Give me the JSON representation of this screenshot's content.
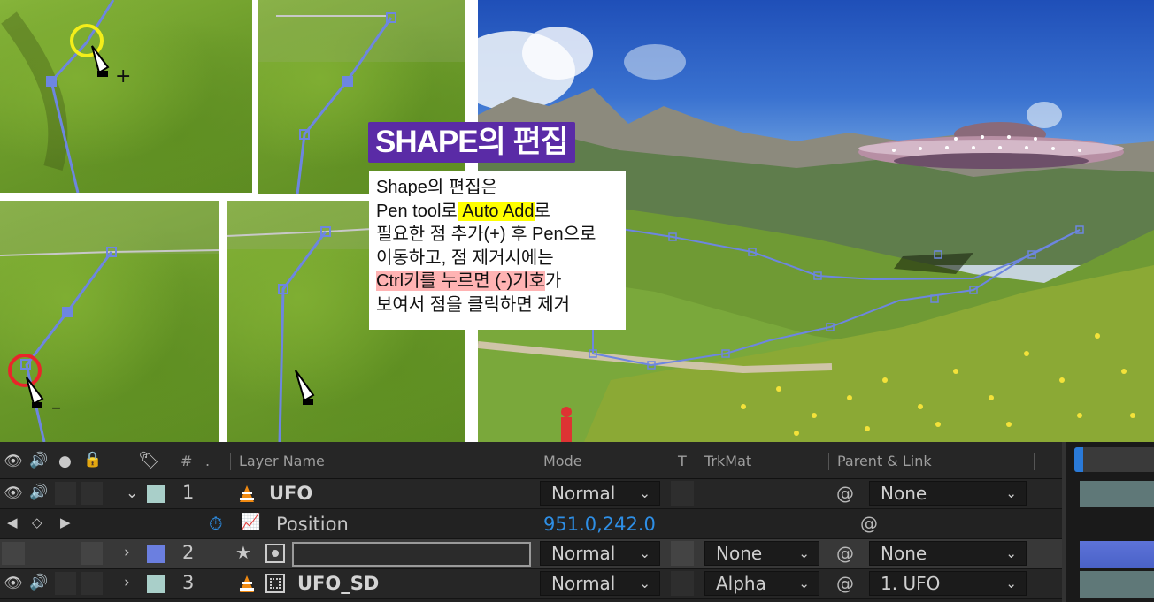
{
  "overlay": {
    "title": "SHAPE의 편집",
    "lines": [
      [
        "Shape의 편집은"
      ],
      [
        "Pen tool로",
        " Auto Add",
        "로"
      ],
      [
        "필요한 점 추가(+) 후 Pen으로"
      ],
      [
        "이동하고, 점 제거시에는"
      ],
      [
        "Ctrl키를 누르면 (-)기호",
        "가"
      ],
      [
        "보여서 점을 클릭하면 제거"
      ]
    ],
    "cursor_add_symbol": "+",
    "cursor_remove_symbol": "–"
  },
  "timeline": {
    "header": {
      "hash": "#",
      "layer_name": "Layer Name",
      "mode": "Mode",
      "t": "T",
      "trkmat": "TrkMat",
      "parent_link": "Parent & Link"
    },
    "layers": [
      {
        "num": "1",
        "name": "UFO",
        "mode": "Normal",
        "trkmat": "",
        "parent": "None",
        "color": "#a9cfc9",
        "expanded": true
      },
      {
        "num": "2",
        "name": "",
        "mode": "Normal",
        "trkmat": "None",
        "parent": "None",
        "color": "#6b7fe0",
        "expanded": false
      },
      {
        "num": "3",
        "name": "UFO_SD",
        "mode": "Normal",
        "trkmat": "Alpha",
        "parent": "1. UFO",
        "color": "#a9cfc9",
        "expanded": false
      }
    ],
    "property": {
      "name": "Position",
      "value": "951.0,242.0"
    }
  },
  "icons": {
    "eye": "eye-icon",
    "audio": "audio-icon",
    "solo": "solo-icon",
    "lock": "lock-icon",
    "label": "label-tag-icon",
    "stopwatch": "stopwatch-icon",
    "graph": "graph-icon",
    "pickwhip": "pickwhip-icon",
    "shape_star": "star-icon",
    "vlc": "cone-icon"
  },
  "colors": {
    "accent_blue": "#2e8fe6",
    "title_bg": "#5a2ba6",
    "highlight_yellow": "#ffff00",
    "highlight_pink": "#ffb3b3"
  }
}
